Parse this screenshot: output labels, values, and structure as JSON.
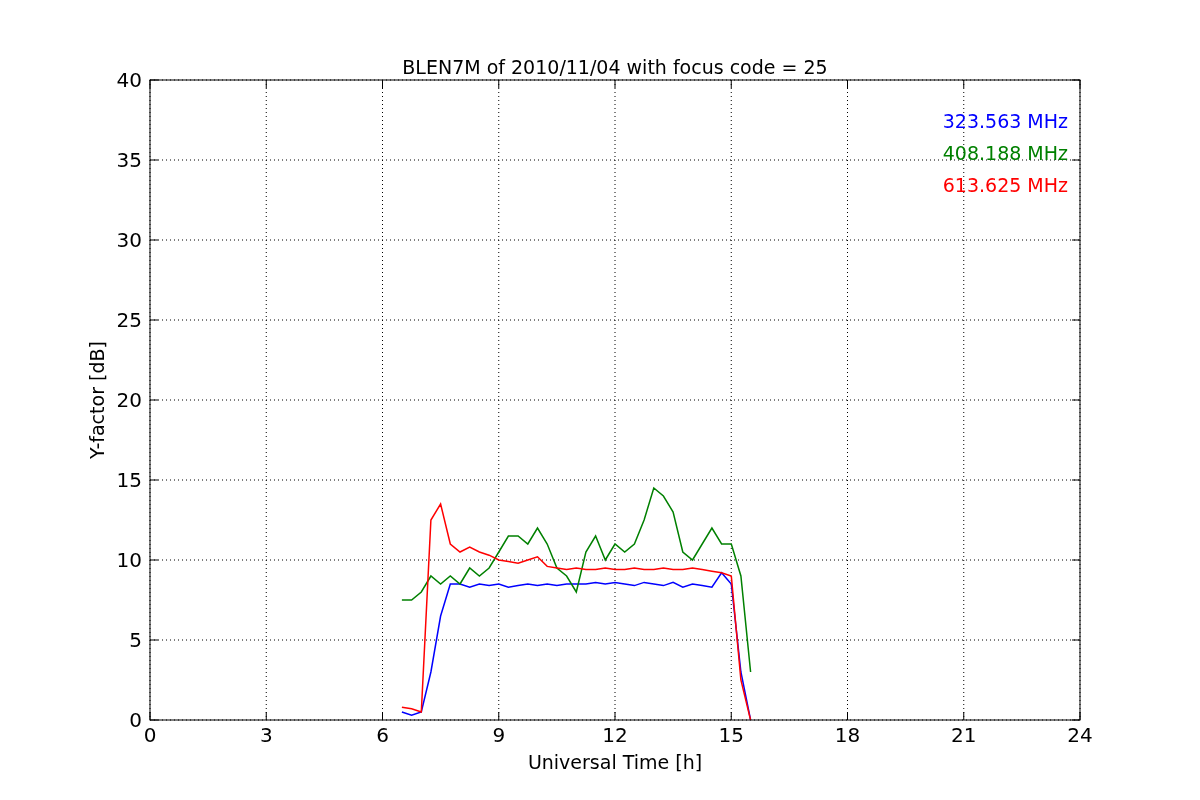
{
  "chart_data": {
    "type": "line",
    "title": "BLEN7M of 2010/11/04 with focus code = 25",
    "xlabel": "Universal Time [h]",
    "ylabel": "Y-factor [dB]",
    "x": [
      6.5,
      6.75,
      7.0,
      7.25,
      7.5,
      7.75,
      8.0,
      8.25,
      8.5,
      8.75,
      9.0,
      9.25,
      9.5,
      9.75,
      10.0,
      10.25,
      10.5,
      10.75,
      11.0,
      11.25,
      11.5,
      11.75,
      12.0,
      12.25,
      12.5,
      12.75,
      13.0,
      13.25,
      13.5,
      13.75,
      14.0,
      14.25,
      14.5,
      14.75,
      15.0,
      15.25,
      15.5
    ],
    "grid": true,
    "xlim": [
      0,
      24
    ],
    "ylim": [
      0,
      40
    ],
    "xticks": [
      0,
      3,
      6,
      9,
      12,
      15,
      18,
      21,
      24
    ],
    "yticks": [
      0,
      5,
      10,
      15,
      20,
      25,
      30,
      35,
      40
    ],
    "series": [
      {
        "name": "323.563 MHz",
        "color": "#0000ff",
        "values": [
          0.5,
          0.3,
          0.5,
          3,
          6.5,
          8.5,
          8.5,
          8.3,
          8.5,
          8.4,
          8.5,
          8.3,
          8.4,
          8.5,
          8.4,
          8.5,
          8.4,
          8.5,
          8.5,
          8.5,
          8.6,
          8.5,
          8.6,
          8.5,
          8.4,
          8.6,
          8.5,
          8.4,
          8.6,
          8.3,
          8.5,
          8.4,
          8.3,
          9.2,
          8.5,
          3,
          0
        ]
      },
      {
        "name": "408.188 MHz",
        "color": "#008000",
        "values": [
          7.5,
          7.5,
          8,
          9,
          8.5,
          9,
          8.5,
          9.5,
          9,
          9.5,
          10.5,
          11.5,
          11.5,
          11,
          12,
          11,
          9.5,
          9,
          8,
          10.5,
          11.5,
          10,
          11,
          10.5,
          11,
          12.5,
          14.5,
          14,
          13,
          10.5,
          10,
          11,
          12,
          11,
          11,
          9,
          3
        ]
      },
      {
        "name": "613.625 MHz",
        "color": "#ff0000",
        "values": [
          0.8,
          0.7,
          0.5,
          12.5,
          13.5,
          11,
          10.5,
          10.8,
          10.5,
          10.3,
          10,
          9.9,
          9.8,
          10,
          10.2,
          9.6,
          9.5,
          9.4,
          9.5,
          9.4,
          9.4,
          9.5,
          9.4,
          9.4,
          9.5,
          9.4,
          9.4,
          9.5,
          9.4,
          9.4,
          9.5,
          9.4,
          9.3,
          9.2,
          9,
          2.5,
          0
        ]
      }
    ]
  }
}
